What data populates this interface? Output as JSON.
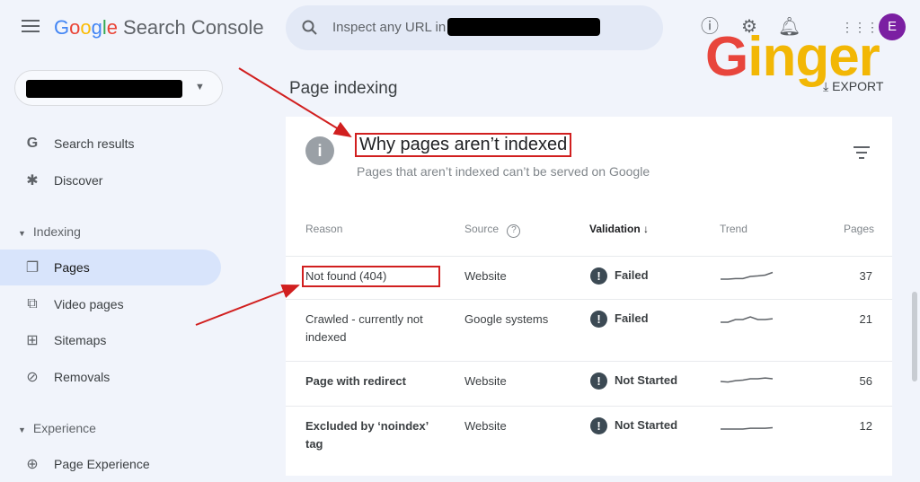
{
  "app": {
    "logo_letters": [
      "G",
      "o",
      "o",
      "g",
      "l",
      "e"
    ],
    "product": "Search Console"
  },
  "search": {
    "placeholder": "Inspect any URL in"
  },
  "header_icons": [
    "help-icon",
    "manage-users-icon",
    "bell-icon",
    "apps-icon"
  ],
  "avatar": {
    "initial": "E",
    "color": "#7b1fa2"
  },
  "watermark": {
    "text": "Ginger"
  },
  "export_label": "EXPORT",
  "sidebar": {
    "items": [
      {
        "label": "Search results",
        "icon": "google-g-icon"
      },
      {
        "label": "Discover",
        "icon": "asterisk-icon"
      }
    ],
    "sections": [
      {
        "label": "Indexing",
        "items": [
          {
            "label": "Pages",
            "icon": "pages-icon",
            "active": true
          },
          {
            "label": "Video pages",
            "icon": "video-pages-icon"
          },
          {
            "label": "Sitemaps",
            "icon": "sitemap-icon"
          },
          {
            "label": "Removals",
            "icon": "removals-icon"
          }
        ]
      },
      {
        "label": "Experience",
        "items": [
          {
            "label": "Page Experience",
            "icon": "page-experience-icon"
          }
        ]
      }
    ]
  },
  "page_title": "Page indexing",
  "card": {
    "title": "Why pages aren’t indexed",
    "subtitle": "Pages that aren’t indexed can’t be served on Google",
    "columns": {
      "reason": "Reason",
      "source": "Source",
      "validation": "Validation",
      "trend": "Trend",
      "pages": "Pages"
    },
    "rows": [
      {
        "reason": "Not found (404)",
        "source": "Website",
        "validation": "Failed",
        "pages": "37",
        "trend": [
          1,
          1,
          1.2,
          1.2,
          2,
          2.2,
          2.5,
          3.5
        ]
      },
      {
        "reason": "Crawled - currently not indexed",
        "source": "Google systems",
        "validation": "Failed",
        "pages": "21",
        "trend": [
          1,
          1,
          2,
          2,
          3,
          2,
          2,
          2.3
        ]
      },
      {
        "reason": "Page with redirect",
        "source": "Website",
        "validation": "Not Started",
        "pages": "56",
        "trend": [
          2,
          1.8,
          2.3,
          2.5,
          3,
          3,
          3.3,
          3
        ]
      },
      {
        "reason": "Excluded by ‘noindex’ tag",
        "source": "Website",
        "validation": "Not Started",
        "pages": "12",
        "trend": [
          1,
          1,
          1,
          1,
          1.3,
          1.3,
          1.3,
          1.5
        ]
      }
    ]
  },
  "annotation_color": "#d11f1f"
}
